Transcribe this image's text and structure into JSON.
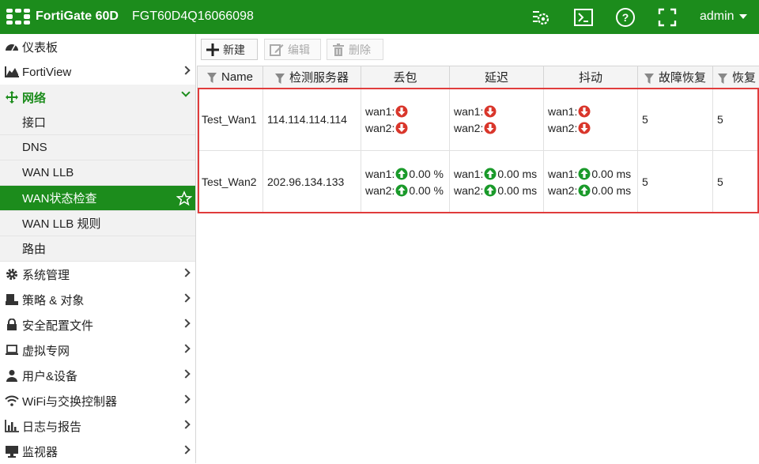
{
  "header": {
    "product": "FortiGate 60D",
    "serial": "FGT60D4Q16066098",
    "user": "admin"
  },
  "sidebar": {
    "items": [
      {
        "label": "仪表板"
      },
      {
        "label": "FortiView"
      },
      {
        "label": "网络"
      },
      {
        "label": "系统管理"
      },
      {
        "label": "策略 & 对象"
      },
      {
        "label": "安全配置文件"
      },
      {
        "label": "虚拟专网"
      },
      {
        "label": "用户&设备"
      },
      {
        "label": "WiFi与交换控制器"
      },
      {
        "label": "日志与报告"
      },
      {
        "label": "监视器"
      }
    ],
    "network_sub": [
      {
        "label": "接口"
      },
      {
        "label": "DNS"
      },
      {
        "label": "WAN LLB"
      },
      {
        "label": "WAN状态检查"
      },
      {
        "label": "WAN LLB 规则"
      },
      {
        "label": "路由"
      }
    ]
  },
  "toolbar": {
    "new_label": "新建",
    "edit_label": "编辑",
    "delete_label": "删除"
  },
  "table": {
    "headers": [
      "Name",
      "检测服务器",
      "丢包",
      "延迟",
      "抖动",
      "故障恢复",
      "恢复"
    ],
    "rows": [
      {
        "name": "Test_Wan1",
        "server": "114.114.114.114",
        "loss": {
          "wan1": "wan1:",
          "wan2": "wan2:",
          "wan1_val": "",
          "wan2_val": "",
          "wan1_status": "down",
          "wan2_status": "down"
        },
        "latency": {
          "wan1": "wan1:",
          "wan2": "wan2:",
          "wan1_val": "",
          "wan2_val": "",
          "wan1_status": "down",
          "wan2_status": "down"
        },
        "jitter": {
          "wan1": "wan1:",
          "wan2": "wan2:",
          "wan1_val": "",
          "wan2_val": "",
          "wan1_status": "down",
          "wan2_status": "down"
        },
        "failover": "5",
        "recover": "5"
      },
      {
        "name": "Test_Wan2",
        "server": "202.96.134.133",
        "loss": {
          "wan1": "wan1:",
          "wan2": "wan2:",
          "wan1_val": "0.00 %",
          "wan2_val": "0.00 %",
          "wan1_status": "up",
          "wan2_status": "up"
        },
        "latency": {
          "wan1": "wan1:",
          "wan2": "wan2:",
          "wan1_val": "0.00 ms",
          "wan2_val": "0.00 ms",
          "wan1_status": "up",
          "wan2_status": "up"
        },
        "jitter": {
          "wan1": "wan1:",
          "wan2": "wan2:",
          "wan1_val": "0.00 ms",
          "wan2_val": "0.00 ms",
          "wan1_status": "up",
          "wan2_status": "up"
        },
        "failover": "5",
        "recover": "5"
      }
    ]
  },
  "colors": {
    "brand": "#1c8c1c",
    "status_up": "#1a9a2a",
    "status_down": "#d9362b",
    "highlight": "#e03c3c"
  },
  "icons": {
    "top": [
      "settings-wheel-icon",
      "cli-console-icon",
      "help-icon",
      "fullscreen-icon"
    ],
    "status_up": "arrow-up-circle-icon",
    "status_down": "arrow-down-circle-icon"
  }
}
